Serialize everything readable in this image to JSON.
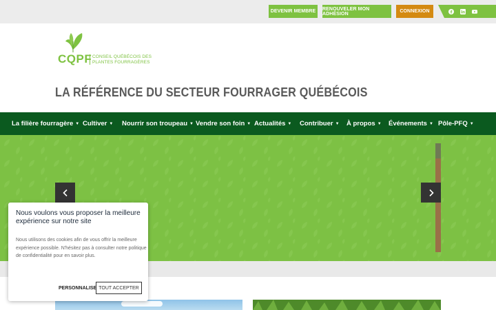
{
  "topbar": {
    "member_label": "Devenir membre",
    "renew_label": "Renouveler mon adhésion",
    "login_label": "Connexion",
    "social": [
      "facebook-icon",
      "linkedin-icon",
      "youtube-icon"
    ]
  },
  "header": {
    "logo_abbr": "CQPF",
    "logo_full": "Conseil québécois des plantes fourragères",
    "tagline": "LA RÉFÉRENCE DU SECTEUR FOURRAGER QUÉBÉCOIS"
  },
  "nav": {
    "items": [
      {
        "label": "La filière fourragère"
      },
      {
        "label": "Cultiver"
      },
      {
        "label": "Nourrir son troupeau"
      },
      {
        "label": "Vendre son foin"
      },
      {
        "label": "Actualités"
      },
      {
        "label": "Contribuer"
      },
      {
        "label": "À propos"
      },
      {
        "label": "Événements"
      },
      {
        "label": "Pôle-PFQ"
      }
    ],
    "caret": "▼"
  },
  "hero": {
    "prev_icon": "chevron-left-icon",
    "next_icon": "chevron-right-icon"
  },
  "cookie": {
    "title": "Nous voulons vous proposer la meilleure expérience sur notre site",
    "text": "Nous utilisons des cookies afin de vous offrir la meilleure expérience possible. N'hésitez pas à consulter notre politique de confidentialité pour en savoir plus.",
    "customize_label": "Personnaliser",
    "accept_label": "Tout accepter"
  },
  "colors": {
    "accent_green": "#7ec241",
    "nav_green": "#0b5a1f",
    "login_orange": "#d48a12",
    "hero_green": "#7dc144"
  }
}
